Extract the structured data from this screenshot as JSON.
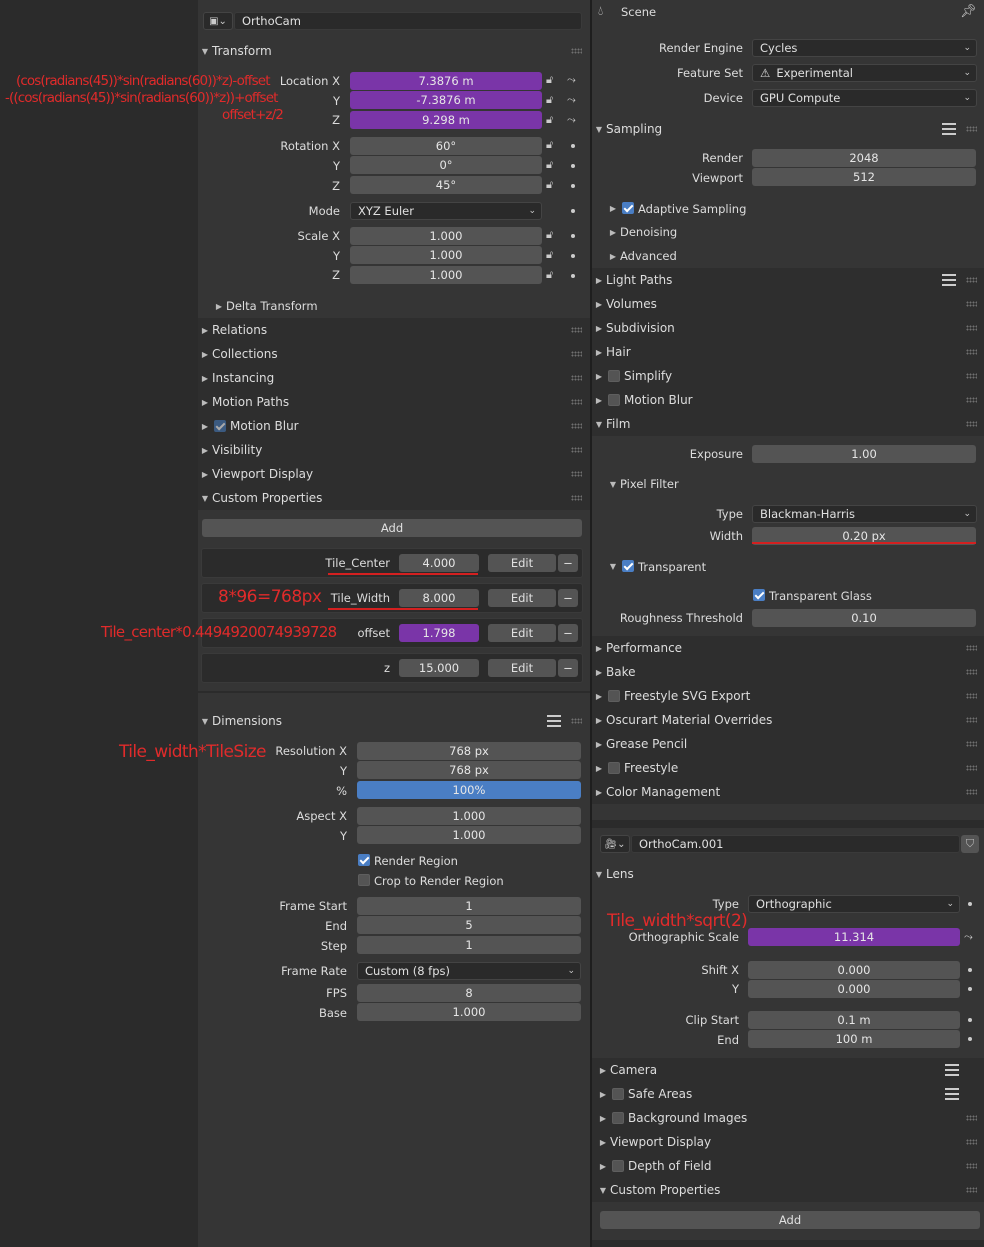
{
  "left": {
    "object_name": "OrthoCam",
    "transform": {
      "header": "Transform",
      "location_label": "Location X",
      "loc_x": "7.3876 m",
      "loc_y": "-7.3876 m",
      "loc_z": "9.298 m",
      "rotation_label": "Rotation X",
      "rot_x": "60°",
      "rot_y": "0°",
      "rot_z": "45°",
      "mode_label": "Mode",
      "mode_value": "XYZ Euler",
      "scale_label": "Scale X",
      "scale_x": "1.000",
      "scale_y": "1.000",
      "scale_z": "1.000",
      "y_label": "Y",
      "z_label": "Z",
      "delta": "Delta Transform"
    },
    "panels": [
      "Relations",
      "Collections",
      "Instancing",
      "Motion Paths",
      "Motion Blur",
      "Visibility",
      "Viewport Display",
      "Custom Properties"
    ],
    "custom_props": {
      "add": "Add",
      "edit": "Edit",
      "minus": "−",
      "items": [
        {
          "name": "Tile_Center",
          "value": "4.000"
        },
        {
          "name": "Tile_Width",
          "value": "8.000"
        },
        {
          "name": "offset",
          "value": "1.798"
        },
        {
          "name": "z",
          "value": "15.000"
        }
      ]
    },
    "dimensions": {
      "header": "Dimensions",
      "res_x_label": "Resolution X",
      "res_x": "768 px",
      "res_y": "768 px",
      "res_pct_label": "%",
      "res_pct": "100%",
      "aspect_label": "Aspect X",
      "aspect_x": "1.000",
      "aspect_y": "1.000",
      "render_region": "Render Region",
      "crop": "Crop to Render Region",
      "frame_start_label": "Frame Start",
      "frame_start": "1",
      "end_label": "End",
      "frame_end": "5",
      "step_label": "Step",
      "step": "1",
      "frame_rate_label": "Frame Rate",
      "frame_rate": "Custom (8 fps)",
      "fps_label": "FPS",
      "fps": "8",
      "base_label": "Base",
      "base": "1.000"
    }
  },
  "right": {
    "scene_title": "Scene",
    "render_engine_label": "Render Engine",
    "render_engine": "Cycles",
    "feature_set_label": "Feature Set",
    "feature_set": "Experimental",
    "device_label": "Device",
    "device": "GPU Compute",
    "sampling": {
      "header": "Sampling",
      "render_label": "Render",
      "render": "2048",
      "viewport_label": "Viewport",
      "viewport": "512",
      "adaptive": "Adaptive Sampling",
      "denoising": "Denoising",
      "advanced": "Advanced"
    },
    "panels1": [
      "Light Paths",
      "Volumes",
      "Subdivision",
      "Hair",
      "Simplify",
      "Motion Blur",
      "Film"
    ],
    "film": {
      "exposure_label": "Exposure",
      "exposure": "1.00",
      "pixel_filter": "Pixel Filter",
      "type_label": "Type",
      "type": "Blackman-Harris",
      "width_label": "Width",
      "width": "0.20 px",
      "transparent": "Transparent",
      "transparent_glass": "Transparent Glass",
      "roughness_label": "Roughness Threshold",
      "roughness": "0.10"
    },
    "panels2": [
      "Performance",
      "Bake",
      "Freestyle SVG Export",
      "Oscurart Material Overrides",
      "Grease Pencil",
      "Freestyle",
      "Color Management"
    ],
    "camera_data_name": "OrthoCam.001",
    "lens": {
      "header": "Lens",
      "type_label": "Type",
      "type": "Orthographic",
      "ortho_label": "Orthographic Scale",
      "ortho": "11.314",
      "shift_x_label": "Shift X",
      "shift_x": "0.000",
      "shift_y": "0.000",
      "clip_start_label": "Clip Start",
      "clip_start": "0.1 m",
      "clip_end_label": "End",
      "clip_end": "100 m"
    },
    "panels3": [
      "Camera",
      "Safe Areas",
      "Background Images",
      "Viewport Display",
      "Depth of Field",
      "Custom Properties"
    ],
    "add": "Add"
  },
  "annotations": {
    "loc_x": "(cos(radians(45))*sin(radians(60))*z)-offset",
    "loc_y": "-((cos(radians(45))*sin(radians(60))*z))+offset",
    "loc_z": "offset+z/2",
    "tile_width": "8*96=768px",
    "offset": "Tile_center*0.4494920074939728",
    "res": "Tile_width*TileSize",
    "ortho": "Tile_width*sqrt(2)"
  },
  "colors": {
    "purple": "#7a35a8",
    "blue": "#4a7ec4",
    "annotation_red": "#e02b2b"
  }
}
